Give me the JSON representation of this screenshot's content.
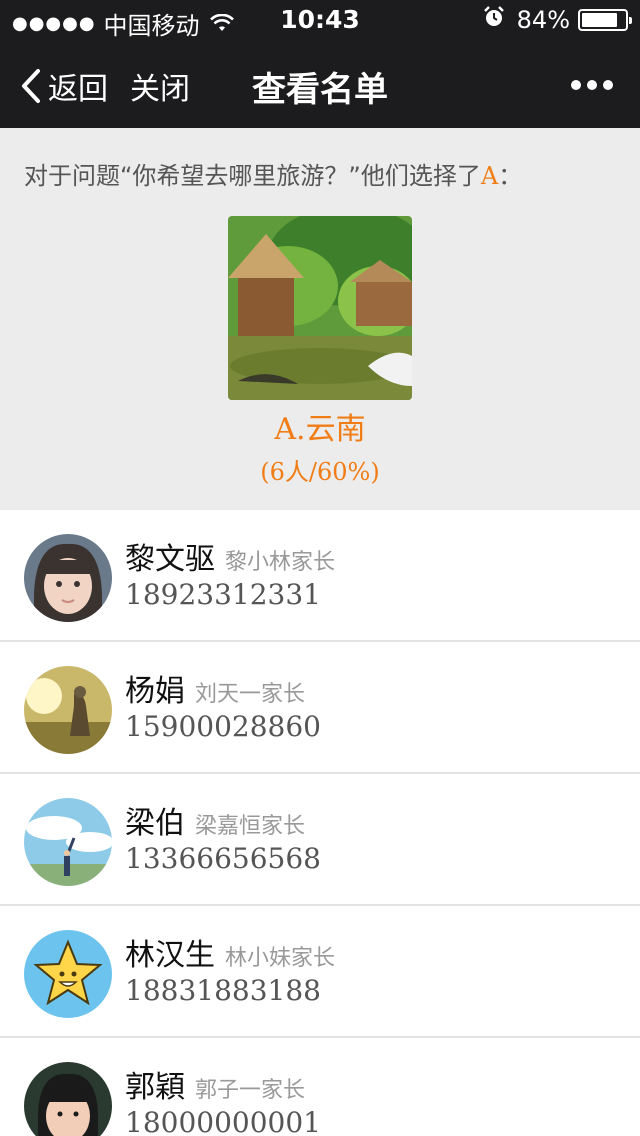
{
  "status_bar": {
    "carrier": "中国移动",
    "time": "10:43",
    "battery": "84%",
    "battery_level": 0.84
  },
  "nav": {
    "back_label": "返回",
    "close_label": "关闭",
    "title": "查看名单"
  },
  "question": {
    "prefix": "对于问题“你希望去哪里旅游？”他们选择了",
    "option_letter": "A",
    "suffix": "：",
    "option_label": "A.云南",
    "option_stat": "(6人/60%)"
  },
  "list": [
    {
      "name": "黎文驱",
      "relation": "黎小林家长",
      "phone": "18923312331",
      "avatar": "girl-portrait"
    },
    {
      "name": "杨娟",
      "relation": "刘天一家长",
      "phone": "15900028860",
      "avatar": "sunset-field"
    },
    {
      "name": "梁伯",
      "relation": "梁嘉恒家长",
      "phone": "13366656568",
      "avatar": "sky-person"
    },
    {
      "name": "林汉生",
      "relation": "林小妹家长",
      "phone": "18831883188",
      "avatar": "star-face"
    },
    {
      "name": "郭穎",
      "relation": "郭子一家长",
      "phone": "18000000001",
      "avatar": "child-portrait"
    }
  ],
  "colors": {
    "nav_bg": "#1c1c1e",
    "accent": "#f07d16",
    "panel_bg": "#ececec"
  }
}
